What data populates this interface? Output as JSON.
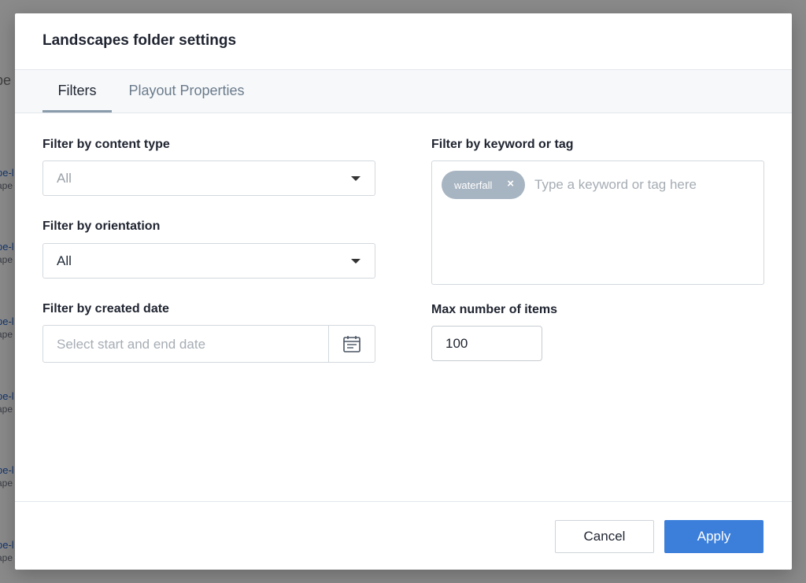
{
  "background": {
    "header_fragment": "pe",
    "items": [
      {
        "title": "pe-l",
        "subtitle": "ape"
      },
      {
        "title": "pe-l",
        "subtitle": "ape"
      },
      {
        "title": "pe-l",
        "subtitle": "ape"
      },
      {
        "title": "pe-l",
        "subtitle": "ape"
      },
      {
        "title": "pe-l",
        "subtitle": "ape"
      },
      {
        "title": "pe-l",
        "subtitle": "ape"
      }
    ]
  },
  "modal": {
    "title": "Landscapes folder settings",
    "tabs": [
      {
        "label": "Filters",
        "active": true
      },
      {
        "label": "Playout Properties",
        "active": false
      }
    ],
    "filters": {
      "content_type": {
        "label": "Filter by content type",
        "value": "All",
        "placeholder": true
      },
      "orientation": {
        "label": "Filter by orientation",
        "value": "All"
      },
      "created_date": {
        "label": "Filter by created date",
        "placeholder": "Select start and end date"
      },
      "keyword": {
        "label": "Filter by keyword or tag",
        "tags": [
          "waterfall"
        ],
        "placeholder": "Type a keyword or tag here"
      },
      "max_items": {
        "label": "Max number of items",
        "value": "100"
      }
    },
    "footer": {
      "cancel_label": "Cancel",
      "apply_label": "Apply"
    }
  },
  "icons": {
    "calendar": "calendar-icon",
    "remove_tag": "close-icon",
    "dropdown": "chevron-down-icon"
  },
  "colors": {
    "accent": "#3b7fdb",
    "tag_chip": "#a7b4c1",
    "link": "#2563c9"
  }
}
